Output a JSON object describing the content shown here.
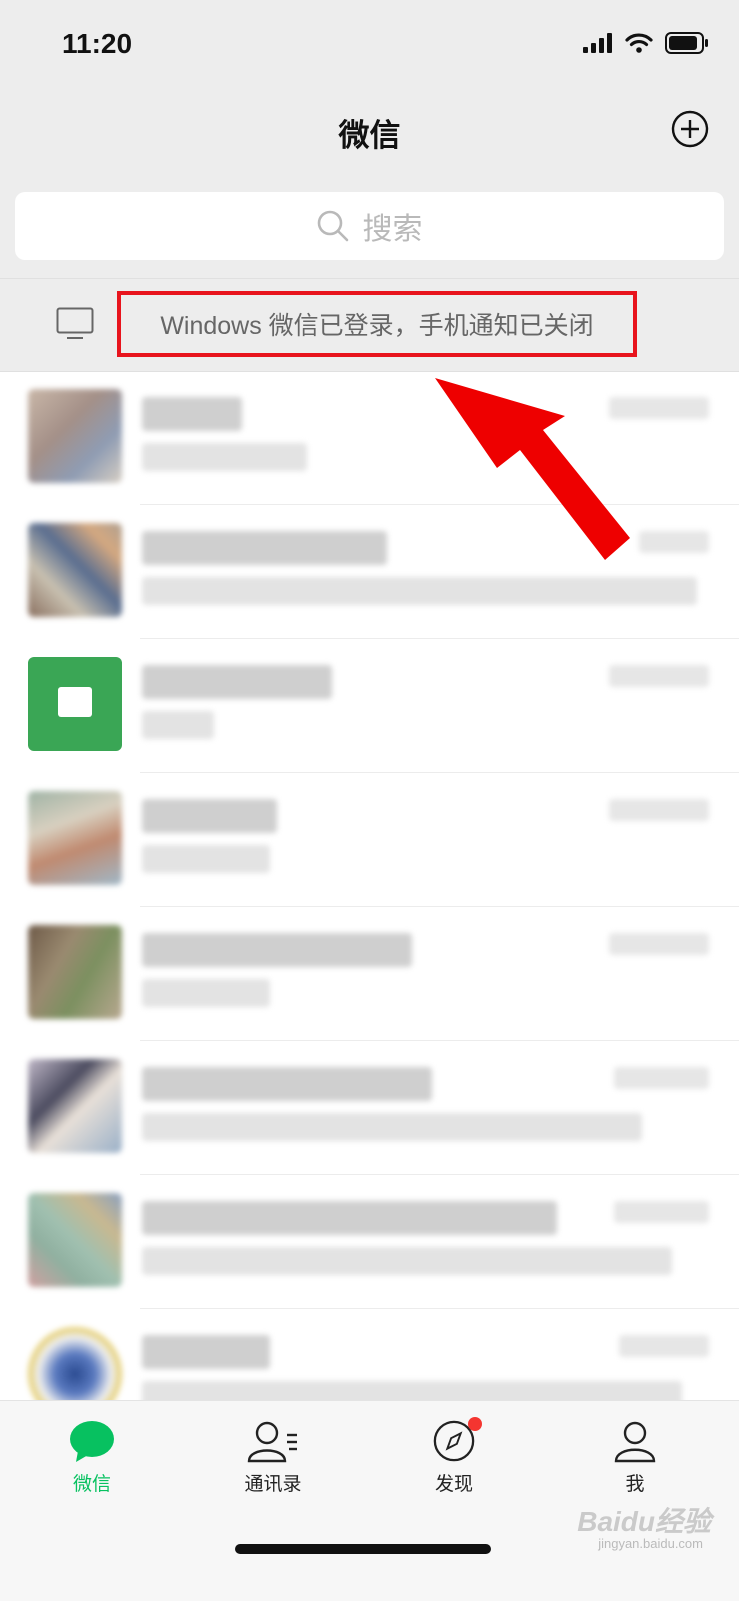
{
  "status_bar": {
    "time": "11:20"
  },
  "header": {
    "title": "微信"
  },
  "search": {
    "placeholder": "搜索"
  },
  "banner": {
    "text": "Windows 微信已登录，手机通知已关闭"
  },
  "tabs": [
    {
      "label": "微信",
      "icon": "chat-bubble-icon",
      "active": true
    },
    {
      "label": "通讯录",
      "icon": "contacts-icon",
      "active": false
    },
    {
      "label": "发现",
      "icon": "compass-icon",
      "active": false,
      "badge_dot": true
    },
    {
      "label": "我",
      "icon": "person-icon",
      "active": false
    }
  ],
  "watermark": {
    "text": "Baidu经验",
    "sub": "jingyan.baidu.com"
  },
  "colors": {
    "accent": "#07c160",
    "highlight": "#e8141d",
    "badge": "#f43530"
  }
}
